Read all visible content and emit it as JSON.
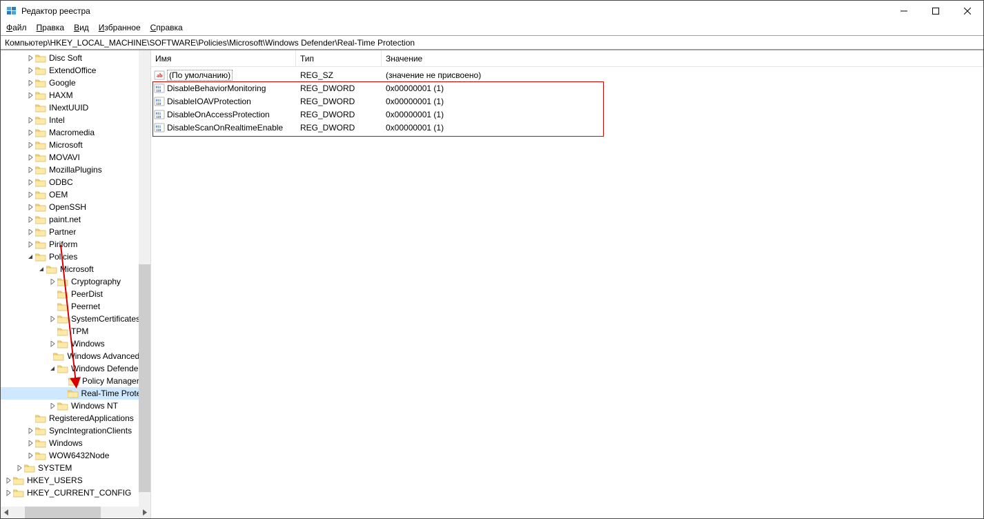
{
  "window": {
    "title": "Редактор реестра"
  },
  "menu": {
    "file": "Файл",
    "edit": "Правка",
    "view": "Вид",
    "favorites": "Избранное",
    "help": "Справка"
  },
  "address": "Компьютер\\HKEY_LOCAL_MACHINE\\SOFTWARE\\Policies\\Microsoft\\Windows Defender\\Real-Time Protection",
  "columns": {
    "name": "Имя",
    "type": "Тип",
    "data": "Значение"
  },
  "values": [
    {
      "icon": "sz",
      "name": "(По умолчанию)",
      "type": "REG_SZ",
      "data": "(значение не присвоено)",
      "default": true
    },
    {
      "icon": "dword",
      "name": "DisableBehaviorMonitoring",
      "type": "REG_DWORD",
      "data": "0x00000001 (1)"
    },
    {
      "icon": "dword",
      "name": "DisableIOAVProtection",
      "type": "REG_DWORD",
      "data": "0x00000001 (1)"
    },
    {
      "icon": "dword",
      "name": "DisableOnAccessProtection",
      "type": "REG_DWORD",
      "data": "0x00000001 (1)"
    },
    {
      "icon": "dword",
      "name": "DisableScanOnRealtimeEnable",
      "type": "REG_DWORD",
      "data": "0x00000001 (1)"
    }
  ],
  "tree": [
    {
      "indent": 2,
      "expander": "closed",
      "label": "Disc Soft"
    },
    {
      "indent": 2,
      "expander": "closed",
      "label": "ExtendOffice"
    },
    {
      "indent": 2,
      "expander": "closed",
      "label": "Google"
    },
    {
      "indent": 2,
      "expander": "closed",
      "label": "HAXM"
    },
    {
      "indent": 2,
      "expander": "none",
      "label": "INextUUID"
    },
    {
      "indent": 2,
      "expander": "closed",
      "label": "Intel"
    },
    {
      "indent": 2,
      "expander": "closed",
      "label": "Macromedia"
    },
    {
      "indent": 2,
      "expander": "closed",
      "label": "Microsoft"
    },
    {
      "indent": 2,
      "expander": "closed",
      "label": "MOVAVI"
    },
    {
      "indent": 2,
      "expander": "closed",
      "label": "MozillaPlugins"
    },
    {
      "indent": 2,
      "expander": "closed",
      "label": "ODBC"
    },
    {
      "indent": 2,
      "expander": "closed",
      "label": "OEM"
    },
    {
      "indent": 2,
      "expander": "closed",
      "label": "OpenSSH"
    },
    {
      "indent": 2,
      "expander": "closed",
      "label": "paint.net"
    },
    {
      "indent": 2,
      "expander": "closed",
      "label": "Partner"
    },
    {
      "indent": 2,
      "expander": "closed",
      "label": "Piriform"
    },
    {
      "indent": 2,
      "expander": "open",
      "label": "Policies"
    },
    {
      "indent": 3,
      "expander": "open",
      "label": "Microsoft"
    },
    {
      "indent": 4,
      "expander": "closed",
      "label": "Cryptography"
    },
    {
      "indent": 4,
      "expander": "none",
      "label": "PeerDist"
    },
    {
      "indent": 4,
      "expander": "none",
      "label": "Peernet"
    },
    {
      "indent": 4,
      "expander": "closed",
      "label": "SystemCertificates"
    },
    {
      "indent": 4,
      "expander": "none",
      "label": "TPM"
    },
    {
      "indent": 4,
      "expander": "closed",
      "label": "Windows"
    },
    {
      "indent": 4,
      "expander": "none",
      "label": "Windows Advanced Threat Protection"
    },
    {
      "indent": 4,
      "expander": "open",
      "label": "Windows Defender"
    },
    {
      "indent": 5,
      "expander": "none",
      "label": "Policy Manager"
    },
    {
      "indent": 5,
      "expander": "none",
      "label": "Real-Time Protection",
      "selected": true
    },
    {
      "indent": 4,
      "expander": "closed",
      "label": "Windows NT"
    },
    {
      "indent": 2,
      "expander": "none",
      "label": "RegisteredApplications"
    },
    {
      "indent": 2,
      "expander": "closed",
      "label": "SyncIntegrationClients"
    },
    {
      "indent": 2,
      "expander": "closed",
      "label": "Windows"
    },
    {
      "indent": 2,
      "expander": "closed",
      "label": "WOW6432Node"
    },
    {
      "indent": 1,
      "expander": "closed",
      "label": "SYSTEM"
    },
    {
      "indent": 0,
      "expander": "closed",
      "label": "HKEY_USERS"
    },
    {
      "indent": 0,
      "expander": "closed",
      "label": "HKEY_CURRENT_CONFIG"
    }
  ]
}
